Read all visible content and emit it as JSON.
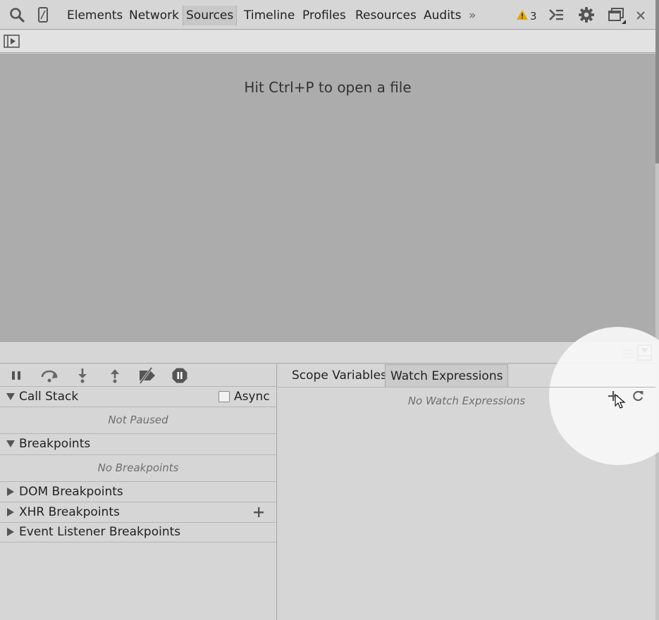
{
  "toolbar": {
    "tabs": [
      {
        "label": "Elements"
      },
      {
        "label": "Network"
      },
      {
        "label": "Sources"
      },
      {
        "label": "Timeline"
      },
      {
        "label": "Profiles"
      },
      {
        "label": "Resources"
      },
      {
        "label": "Audits"
      }
    ],
    "active_tab": "Sources",
    "more_label": "»",
    "warning_count": "3",
    "icons": [
      "search-icon",
      "device-mode-icon",
      "warning-icon",
      "console-drawer-icon",
      "gear-icon",
      "dock-side-icon",
      "close-icon"
    ]
  },
  "navigator": {
    "toggle_icon": "show-navigator-icon"
  },
  "editor": {
    "hint": "Hit Ctrl+P to open a file"
  },
  "splitbar": {
    "icons": [
      "menu-icon",
      "toggle-drawer-icon"
    ]
  },
  "debugger": {
    "controls": [
      "pause-icon",
      "step-over-icon",
      "step-into-icon",
      "step-out-icon",
      "deactivate-breakpoints-icon",
      "pause-on-exceptions-icon"
    ],
    "call_stack": {
      "title": "Call Stack",
      "async_label": "Async",
      "async_checked": false,
      "empty": "Not Paused"
    },
    "breakpoints": {
      "title": "Breakpoints",
      "empty": "No Breakpoints"
    },
    "dom_breakpoints": {
      "title": "DOM Breakpoints"
    },
    "xhr_breakpoints": {
      "title": "XHR Breakpoints"
    },
    "event_listener_breakpoints": {
      "title": "Event Listener Breakpoints"
    }
  },
  "sidebar": {
    "tabs": [
      {
        "label": "Scope Variables"
      },
      {
        "label": "Watch Expressions"
      }
    ],
    "active_tab": "Watch Expressions",
    "watch": {
      "empty": "No Watch Expressions"
    }
  },
  "colors": {
    "warning": "#e6a800",
    "accent_gray": "#555555"
  }
}
